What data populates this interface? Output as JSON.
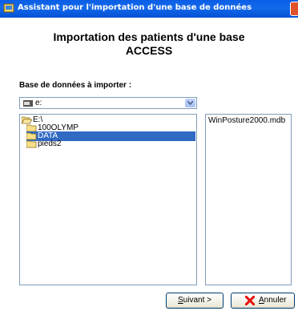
{
  "window": {
    "title": "Assistant pour l'importation d'une base de données",
    "heading_line1": "Importation des patients d'une base",
    "heading_line2": "ACCESS"
  },
  "import_form": {
    "prompt_label": "Base de données à importer :",
    "drive_select_value": "e:",
    "directories": [
      {
        "label": "E:\\",
        "level": 0,
        "icon": "open-folder-icon",
        "selected": false
      },
      {
        "label": "100OLYMP",
        "level": 1,
        "icon": "folder-icon",
        "selected": false
      },
      {
        "label": "DATA",
        "level": 1,
        "icon": "folder-icon",
        "selected": true
      },
      {
        "label": "pieds2",
        "level": 1,
        "icon": "folder-icon",
        "selected": false
      }
    ],
    "files": [
      "WinPosture2000.mdb"
    ]
  },
  "buttons": {
    "next": {
      "mnemonic": "S",
      "rest": "uivant",
      "suffix": " >"
    },
    "cancel": {
      "mnemonic": "A",
      "rest": "nnuler"
    }
  },
  "colors": {
    "titlebar": "#0a5ee6",
    "selection": "#316ac5",
    "border": "#7f9db9",
    "cancel_icon": "#e8110e"
  }
}
